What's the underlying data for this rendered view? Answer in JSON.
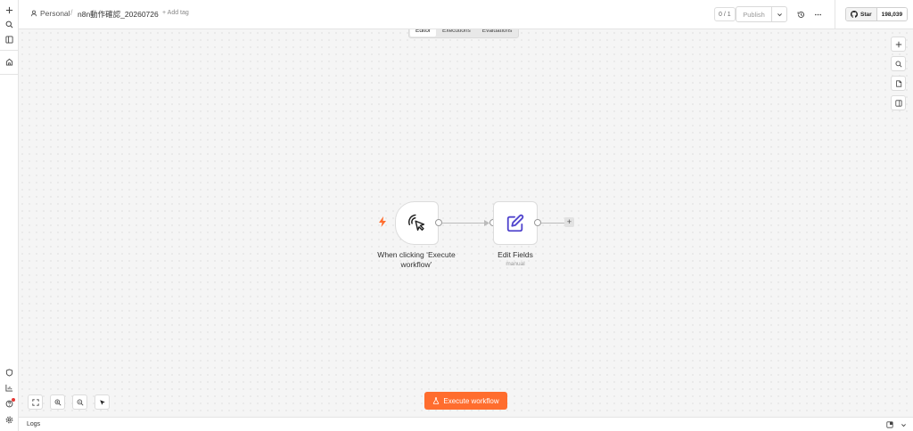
{
  "breadcrumb": {
    "project": "Personal",
    "separator": "/",
    "workflow_name": "n8n動作確認_20260726",
    "add_tag": "+ Add tag"
  },
  "header": {
    "version": "0 / 1",
    "publish_label": "Publish",
    "github_star_label": "Star",
    "github_star_count": "198,039"
  },
  "tabs": [
    {
      "label": "Editor",
      "active": true
    },
    {
      "label": "Executions",
      "active": false
    },
    {
      "label": "Evaluations",
      "active": false
    }
  ],
  "nodes": {
    "trigger": {
      "label": "When clicking ‘Execute workflow’"
    },
    "edit_fields": {
      "label": "Edit Fields",
      "subtitle": "manual"
    }
  },
  "execute_button": {
    "label": "Execute workflow"
  },
  "logs": {
    "label": "Logs"
  },
  "colors": {
    "accent": "#ff6d2e",
    "edit_icon": "#5145cd",
    "canvas_bg": "#f5f5f5"
  },
  "icons": {
    "sidebar": [
      "plus-icon",
      "search-icon",
      "panel-icon",
      "home-icon",
      "shield-icon",
      "chart-icon",
      "help-icon",
      "gear-icon"
    ],
    "right_tools": [
      "plus-icon",
      "search-icon",
      "sticky-note-icon",
      "panel-right-icon"
    ],
    "bottom_tools": [
      "fit-view-icon",
      "zoom-in-icon",
      "zoom-out-icon",
      "pointer-icon"
    ]
  }
}
